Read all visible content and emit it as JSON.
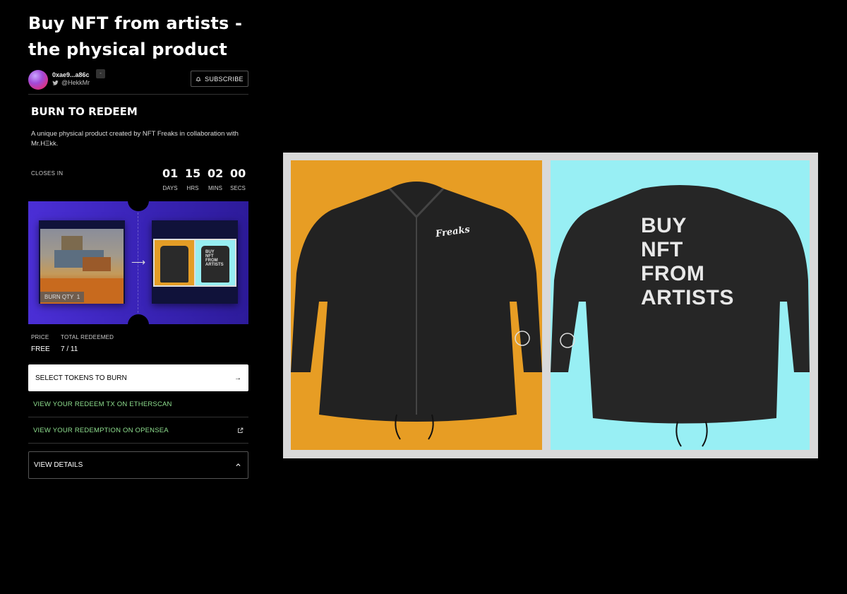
{
  "page": {
    "title": "Buy NFT from artists - the physical product"
  },
  "creator": {
    "address": "0xae9...a86c",
    "badge": "-",
    "twitter_handle": "@HekkMr",
    "subscribe_label": "SUBSCRIBE"
  },
  "burn": {
    "heading": "BURN TO REDEEM",
    "description": "A unique physical product created by NFT Freaks in collaboration with Mr.HΞkk.",
    "closes_label": "CLOSES IN",
    "timer": [
      {
        "value": "01",
        "label": "DAYS"
      },
      {
        "value": "15",
        "label": "HRS"
      },
      {
        "value": "02",
        "label": "MINS"
      },
      {
        "value": "00",
        "label": "SECS"
      }
    ],
    "burn_qty_label": "BURN QTY",
    "burn_qty_value": "1",
    "redeem_thumb_text": "BUY\nNFT\nFROM\nARTISTS"
  },
  "stats": {
    "price_label": "PRICE",
    "price_value": "FREE",
    "redeemed_label": "TOTAL REDEEMED",
    "redeemed_value": "7 / 11"
  },
  "actions": {
    "select_tokens": "SELECT TOKENS TO BURN",
    "etherscan_link": "VIEW YOUR REDEEM TX ON ETHERSCAN",
    "opensea_link": "VIEW YOUR REDEMPTION ON OPENSEA",
    "view_details": "VIEW DETAILS"
  },
  "hero": {
    "left_logo_text": "Freaks",
    "right_back_text": [
      "BUY",
      "NFT",
      "FROM",
      "ARTISTS"
    ],
    "colors": {
      "left_bg": "#e79d24",
      "right_bg": "#98eff4",
      "frame": "#d9d9d9"
    }
  },
  "colors": {
    "accent_link": "#8fe08f",
    "card_gradient_start": "#4b2fd6",
    "card_gradient_end": "#2d1b9a"
  }
}
